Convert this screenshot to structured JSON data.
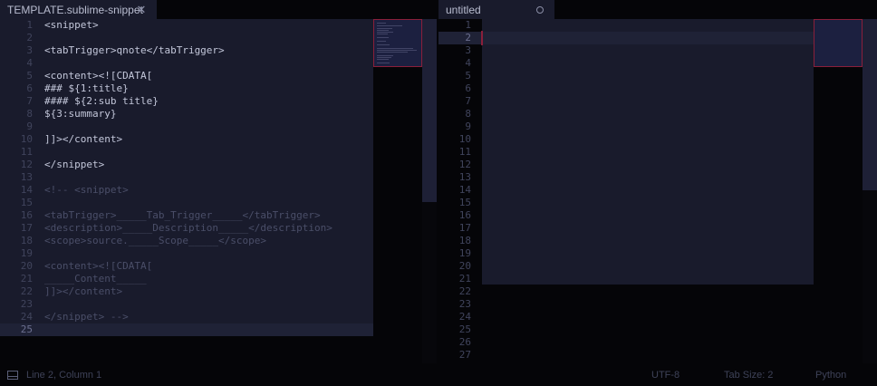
{
  "tabs": [
    {
      "label": "TEMPLATE.sublime-snippet",
      "state": "close",
      "active": false
    },
    {
      "label": "untitled",
      "state": "dirty",
      "active": true
    }
  ],
  "left_pane": {
    "line_numbers": [
      "1",
      "2",
      "3",
      "4",
      "5",
      "6",
      "7",
      "8",
      "9",
      "10",
      "11",
      "12",
      "13",
      "14",
      "15",
      "16",
      "17",
      "18",
      "19",
      "20",
      "21",
      "22",
      "23",
      "24",
      "25"
    ],
    "current_line": 25,
    "lines": [
      {
        "t": "<snippet>",
        "s": "n"
      },
      {
        "t": "",
        "s": "n"
      },
      {
        "t": "<tabTrigger>qnote</tabTrigger>",
        "s": "n"
      },
      {
        "t": "",
        "s": "n"
      },
      {
        "t": "<content><![CDATA[",
        "s": "n"
      },
      {
        "t": "### ${1:title}",
        "s": "n"
      },
      {
        "t": "#### ${2:sub title}",
        "s": "n"
      },
      {
        "t": "${3:summary}",
        "s": "n"
      },
      {
        "t": "",
        "s": "n"
      },
      {
        "t": "]]></content>",
        "s": "n"
      },
      {
        "t": "",
        "s": "n"
      },
      {
        "t": "</snippet>",
        "s": "n"
      },
      {
        "t": "",
        "s": "n"
      },
      {
        "t": "<!-- <snippet>",
        "s": "c"
      },
      {
        "t": "",
        "s": "c"
      },
      {
        "t": "<tabTrigger>_____Tab_Trigger_____</tabTrigger>",
        "s": "c"
      },
      {
        "t": "<description>_____Description_____</description>",
        "s": "c"
      },
      {
        "t": "<scope>source._____Scope_____</scope>",
        "s": "c"
      },
      {
        "t": "",
        "s": "c"
      },
      {
        "t": "<content><![CDATA[",
        "s": "c"
      },
      {
        "t": "_____Content_____",
        "s": "c"
      },
      {
        "t": "]]></content>",
        "s": "c"
      },
      {
        "t": "",
        "s": "c"
      },
      {
        "t": "</snippet> -->",
        "s": "c"
      },
      {
        "t": "",
        "s": "c"
      }
    ]
  },
  "right_pane": {
    "line_numbers": [
      "1",
      "2",
      "3",
      "4",
      "5",
      "6",
      "7",
      "8",
      "9",
      "10",
      "11",
      "12",
      "13",
      "14",
      "15",
      "16",
      "17",
      "18",
      "19",
      "20",
      "21",
      "22",
      "23",
      "24",
      "25",
      "26",
      "27"
    ],
    "current_line": 2
  },
  "status": {
    "position": "Line 2, Column 1",
    "encoding": "UTF-8",
    "tab_size": "Tab Size: 2",
    "syntax": "Python"
  },
  "colors": {
    "accent_border": "#8a1f3a",
    "panel_bg": "#191b2c",
    "background": "#050508"
  }
}
